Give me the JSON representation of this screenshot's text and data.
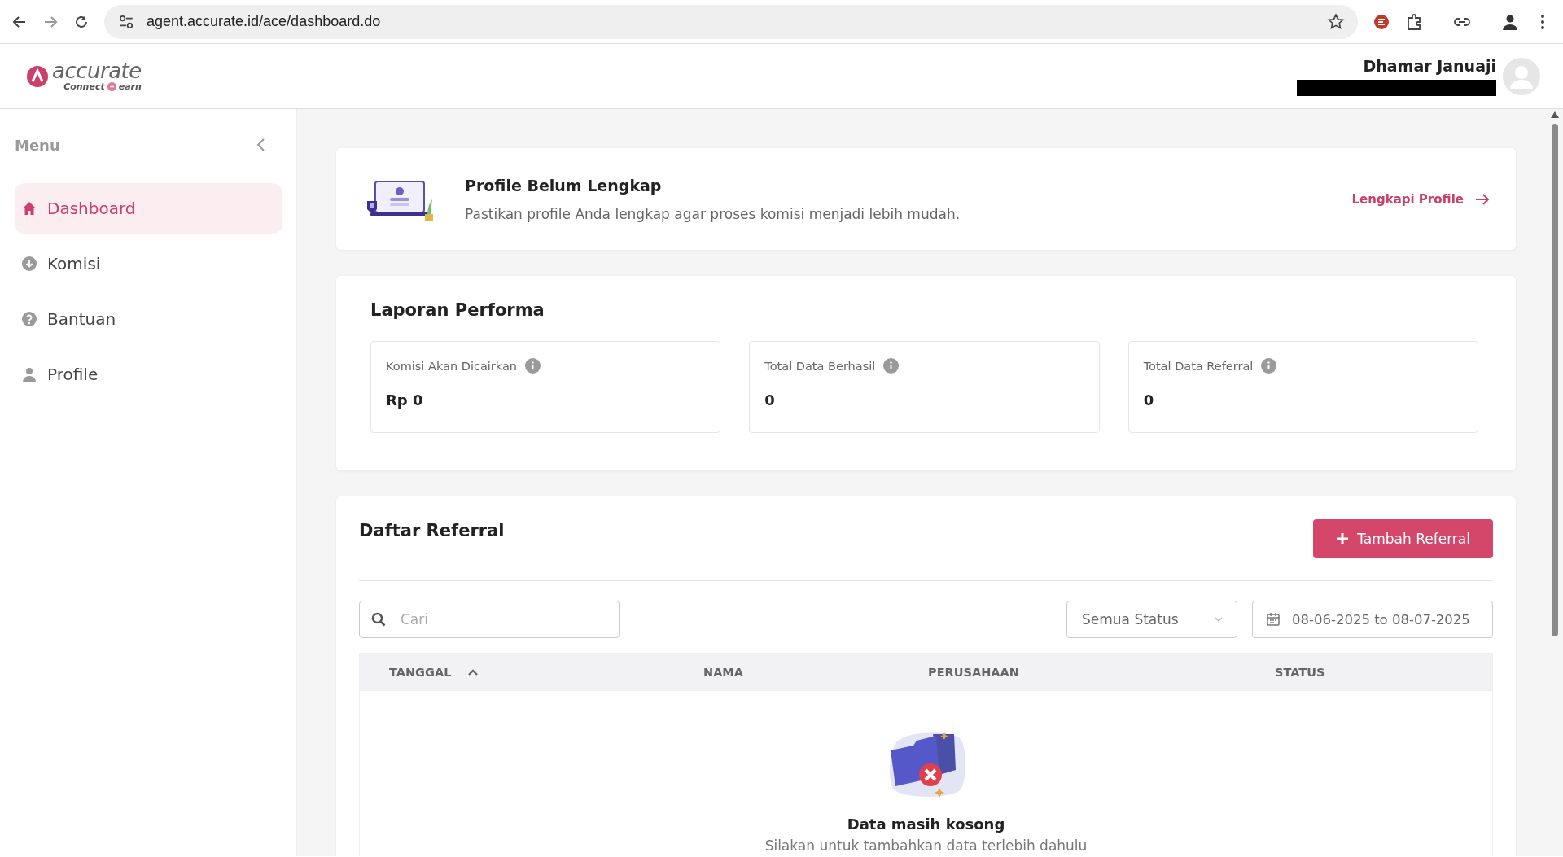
{
  "browser": {
    "url": "agent.accurate.id/ace/dashboard.do"
  },
  "header": {
    "logo_name": "accurate",
    "logo_tagline_left": "Connect",
    "logo_tagline_right": "earn",
    "user_name": "Dhamar Januaji"
  },
  "sidebar": {
    "title": "Menu",
    "items": [
      {
        "label": "Dashboard",
        "kind": "home",
        "selected": true
      },
      {
        "label": "Komisi",
        "kind": "download",
        "selected": false
      },
      {
        "label": "Bantuan",
        "kind": "help",
        "selected": false
      },
      {
        "label": "Profile",
        "kind": "person",
        "selected": false
      }
    ]
  },
  "profile_notice": {
    "title": "Profile Belum Lengkap",
    "text": "Pastikan profile Anda lengkap agar proses komisi menjadi lebih mudah.",
    "link": "Lengkapi Profile"
  },
  "performance": {
    "title": "Laporan Performa",
    "stats": [
      {
        "label": "Komisi Akan Dicairkan",
        "value": "Rp 0"
      },
      {
        "label": "Total Data Berhasil",
        "value": "0"
      },
      {
        "label": "Total Data Referral",
        "value": "0"
      }
    ]
  },
  "referrals": {
    "title": "Daftar Referral",
    "add_button": "Tambah Referral",
    "search": {
      "placeholder": "Cari"
    },
    "status_filter": "Semua Status",
    "date_range": "08-06-2025 to 08-07-2025",
    "columns": [
      {
        "label": "TANGGAL",
        "sorted": true
      },
      {
        "label": "NAMA",
        "sorted": false
      },
      {
        "label": "PERUSAHAAN",
        "sorted": false
      },
      {
        "label": "STATUS",
        "sorted": false
      }
    ],
    "empty": {
      "title": "Data masih kosong",
      "text": "Silakan untuk tambahkan data terlebih dahulu"
    }
  }
}
